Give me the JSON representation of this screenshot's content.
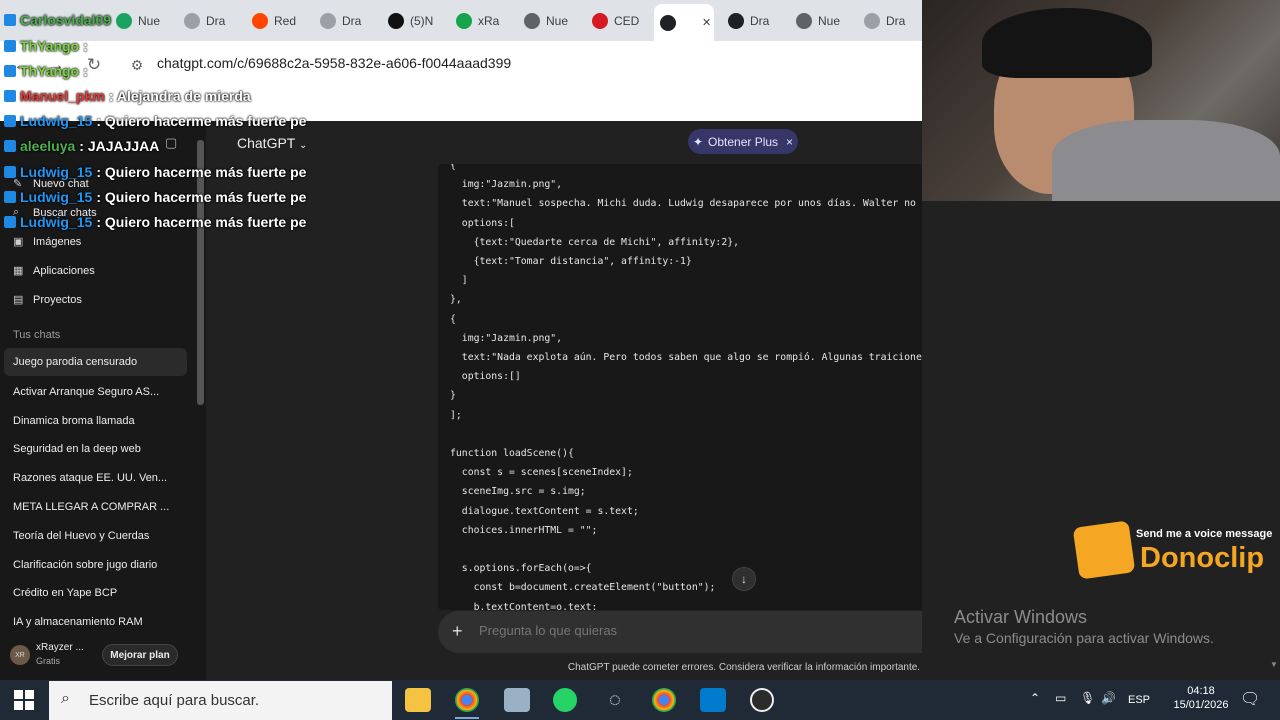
{
  "browser": {
    "tabs": [
      {
        "label": "Nue",
        "color": "#1aa260"
      },
      {
        "label": "Dra",
        "color": "#9aa0a6"
      },
      {
        "label": "Red",
        "color": "#ff4500"
      },
      {
        "label": "Dra",
        "color": "#9aa0a6"
      },
      {
        "label": "(5)‪N",
        "color": "#111111"
      },
      {
        "label": "xRa",
        "color": "#16a34a"
      },
      {
        "label": "Nue",
        "color": "#5f6368"
      },
      {
        "label": "CED",
        "color": "#d71920"
      },
      {
        "label": "",
        "color": "#202124",
        "active": true
      },
      {
        "label": "Dra",
        "color": "#202124"
      },
      {
        "label": "Nue",
        "color": "#5f6368"
      },
      {
        "label": "Dra",
        "color": "#9aa0a6"
      }
    ],
    "url": "chatgpt.com/c/69688c2a-5958-832e-a606-f0044aaad399"
  },
  "sidebar": {
    "items": [
      {
        "icon": "new-chat-icon",
        "label": "Nuevo chat"
      },
      {
        "icon": "search-icon",
        "label": "Buscar chats"
      },
      {
        "icon": "images-icon",
        "label": "Imágenes"
      },
      {
        "icon": "apps-icon",
        "label": "Aplicaciones"
      },
      {
        "icon": "folder-icon",
        "label": "Proyectos"
      }
    ],
    "section_title": "Tus chats",
    "chats": [
      "Juego parodia censurado",
      "Activar Arranque Seguro AS...",
      "Dinamica broma llamada",
      "Seguridad en la deep web",
      "Razones ataque EE. UU. Ven...",
      "META LLEGAR A COMPRAR ...",
      "Teoría del Huevo y Cuerdas",
      "Clarificación sobre jugo diario",
      "Crédito en Yape BCP",
      "IA y almacenamiento RAM"
    ],
    "user": {
      "initials": "XR",
      "name": "xRayzer ...",
      "plan": "Gratis",
      "upgrade_label": "Mejorar plan"
    }
  },
  "main": {
    "model_label": "ChatGPT",
    "plus_label": "Obtener Plus",
    "composer_placeholder": "Pregunta lo que quieras",
    "disclaimer": "ChatGPT puede cometer errores. Considera verificar la información importante."
  },
  "code_lines": [
    "{",
    "  img:\"Jazmin.png\",",
    "  text:\"Manuel sospecha. Michi duda. Ludwig desaparece por unos días. Walter no deja de vigilar.\",",
    "  options:[",
    "    {text:\"Quedarte cerca de Michi\", affinity:2},",
    "    {text:\"Tomar distancia\", affinity:-1}",
    "  ]",
    "},",
    "{",
    "  img:\"Jazmin.png\",",
    "  text:\"Nada explota aún. Pero todos saben que algo se rompió. Algunas traiciones no necesitan pru",
    "  options:[]",
    "}",
    "];",
    "",
    "function loadScene(){",
    "  const s = scenes[sceneIndex];",
    "  sceneImg.src = s.img;",
    "  dialogue.textContent = s.text;",
    "  choices.innerHTML = \"\";",
    "",
    "  s.options.forEach(o=>{",
    "    const b=document.createElement(\"button\");",
    "    b.textContent=o.text;"
  ],
  "chat_overlay": [
    {
      "user": "Carlosvidal09",
      "msg": "",
      "color": "#4caf50"
    },
    {
      "user": "ThYango",
      "msg": ":",
      "color": "#7cd642"
    },
    {
      "user": "ThYango",
      "msg": ":",
      "color": "#7cd642"
    },
    {
      "user": "Manuel_pkm",
      "msg": ": Alejandra de mierda",
      "color": "#e53935"
    },
    {
      "user": "Ludwig_15",
      "msg": ": Quiero hacerme más fuerte pe",
      "color": "#2196f3"
    },
    {
      "user": "aleeluya",
      "msg": ": JAJAJJAA",
      "color": "#4caf50"
    },
    {
      "user": "Ludwig_15",
      "msg": ": Quiero hacerme más fuerte pe",
      "color": "#2196f3"
    },
    {
      "user": "Ludwig_15",
      "msg": ": Quiero hacerme más fuerte pe",
      "color": "#2196f3"
    },
    {
      "user": "Ludwig_15",
      "msg": ": Quiero hacerme más fuerte pe",
      "color": "#2196f3"
    }
  ],
  "watermark": {
    "title": "Activar Windows",
    "subtitle": "Ve a Configuración para activar Windows."
  },
  "donoclip": {
    "tagline": "Send me a voice message",
    "brand": "Donoclip"
  },
  "taskbar": {
    "search_placeholder": "Escribe aquí para buscar.",
    "lang": "ESP",
    "time": "04:18",
    "date": "15/01/2026"
  }
}
